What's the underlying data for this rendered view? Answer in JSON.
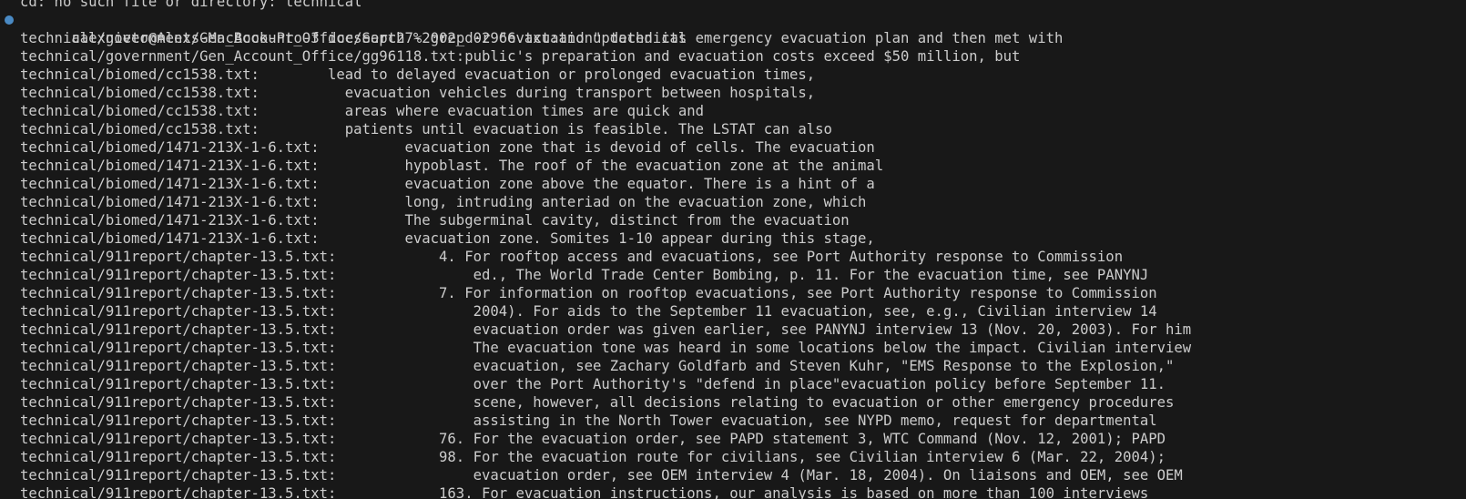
{
  "terminal": {
    "colors": {
      "background": "#181818",
      "text": "#cccccc",
      "prompt_indicator": "#4a8ac4"
    },
    "prompt_indicator_icon": "circle-icon",
    "previous_output": "cd: no such file or directory: technical",
    "prompt": "alexnieto@Alexs-MacBook-Pro-3 docsearch % ",
    "command": "grep -r \"evacuation\" technical",
    "output_lines": [
      "technical/government/Gen_Account_Office/Sept27-2002_d02966.txt:and updated its emergency evacuation plan and then met with",
      "technical/government/Gen_Account_Office/gg96118.txt:public's preparation and evacuation costs exceed $50 million, but",
      "technical/biomed/cc1538.txt:        lead to delayed evacuation or prolonged evacuation times,",
      "technical/biomed/cc1538.txt:          evacuation vehicles during transport between hospitals,",
      "technical/biomed/cc1538.txt:          areas where evacuation times are quick and",
      "technical/biomed/cc1538.txt:          patients until evacuation is feasible. The LSTAT can also",
      "technical/biomed/1471-213X-1-6.txt:          evacuation zone that is devoid of cells. The evacuation",
      "technical/biomed/1471-213X-1-6.txt:          hypoblast. The roof of the evacuation zone at the animal",
      "technical/biomed/1471-213X-1-6.txt:          evacuation zone above the equator. There is a hint of a",
      "technical/biomed/1471-213X-1-6.txt:          long, intruding anteriad on the evacuation zone, which",
      "technical/biomed/1471-213X-1-6.txt:          The subgerminal cavity, distinct from the evacuation",
      "technical/biomed/1471-213X-1-6.txt:          evacuation zone. Somites 1-10 appear during this stage,",
      "technical/911report/chapter-13.5.txt:            4. For rooftop access and evacuations, see Port Authority response to Commission",
      "technical/911report/chapter-13.5.txt:                ed., The World Trade Center Bombing, p. 11. For the evacuation time, see PANYNJ",
      "technical/911report/chapter-13.5.txt:            7. For information on rooftop evacuations, see Port Authority response to Commission",
      "technical/911report/chapter-13.5.txt:                2004). For aids to the September 11 evacuation, see, e.g., Civilian interview 14",
      "technical/911report/chapter-13.5.txt:                evacuation order was given earlier, see PANYNJ interview 13 (Nov. 20, 2003). For him",
      "technical/911report/chapter-13.5.txt:                The evacuation tone was heard in some locations below the impact. Civilian interview",
      "technical/911report/chapter-13.5.txt:                evacuation, see Zachary Goldfarb and Steven Kuhr, \"EMS Response to the Explosion,\"",
      "technical/911report/chapter-13.5.txt:                over the Port Authority's \"defend in place\"evacuation policy before September 11.",
      "technical/911report/chapter-13.5.txt:                scene, however, all decisions relating to evacuation or other emergency procedures",
      "technical/911report/chapter-13.5.txt:                assisting in the North Tower evacuation, see NYPD memo, request for departmental",
      "technical/911report/chapter-13.5.txt:            76. For the evacuation order, see PAPD statement 3, WTC Command (Nov. 12, 2001); PAPD",
      "technical/911report/chapter-13.5.txt:            98. For the evacuation route for civilians, see Civilian interview 6 (Mar. 22, 2004);",
      "technical/911report/chapter-13.5.txt:                evacuation order, see OEM interview 4 (Mar. 18, 2004). On liaisons and OEM, see OEM",
      "technical/911report/chapter-13.5.txt:            163. For evacuation instructions, our analysis is based on more than 100 interviews"
    ]
  }
}
